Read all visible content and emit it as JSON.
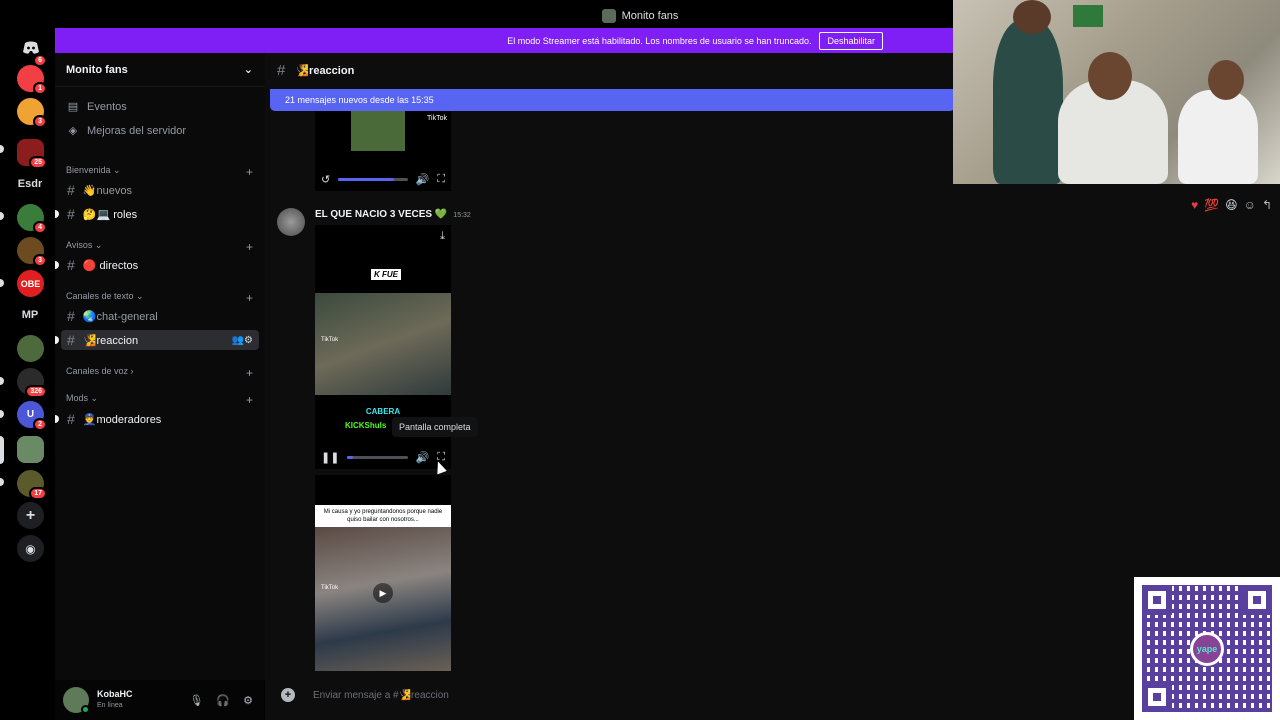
{
  "window": {
    "title": "Monito fans"
  },
  "banner": {
    "text": "El modo Streamer está habilitado. Los nombres de usuario se han truncado.",
    "button": "Deshabilitar"
  },
  "rail": {
    "text_items": [
      "Esdr",
      "MP"
    ],
    "badges": [
      "6",
      "1",
      "3",
      "25",
      "4",
      "3",
      "326",
      "2",
      "17"
    ],
    "server_labels": [
      "OBE",
      "U"
    ]
  },
  "sidebar": {
    "guild_name": "Monito fans",
    "top_items": [
      {
        "label": "Eventos",
        "icon": "calendar-icon"
      },
      {
        "label": "Mejoras del servidor",
        "icon": "boost-icon"
      }
    ],
    "categories": {
      "bienvenida": "Bienvenida",
      "avisos": "Avisos",
      "texto": "Canales de texto",
      "voz": "Canales de voz",
      "mods": "Mods"
    },
    "channels": {
      "nuevos": "👋nuevos",
      "roles": "🤔💻 roles",
      "directos": "🔴 directos",
      "chat_general": "🌏chat-general",
      "reaccion": "🧏reaccion",
      "moderadores": "👮moderadores"
    },
    "channel_tools": "👥⚙"
  },
  "user": {
    "name": "KobaHC",
    "status": "En línea"
  },
  "chat": {
    "channel_name": "🧏reaccion",
    "new_messages": "21 mensajes nuevos desde las 15:35",
    "author": "EL QUE NACIO 3 VECES 💚",
    "time": "15:32",
    "tooltip": "Pantalla completa",
    "video1_label": "K FUE",
    "video1_bottom": "CABERA",
    "video1_kick": "KICKShuls",
    "video2_caption": "Mi causa y yo preguntandonos porque nadie quiso bailar con nosotros...",
    "tiktok": "TikTok",
    "input_placeholder": "Enviar mensaje a #🧏reaccion",
    "progress_top": 0.8,
    "progress_main": 0.1
  },
  "qr": {
    "logo": "yape"
  },
  "colors": {
    "accent": "#5865f2",
    "streamer": "#7f1ef5",
    "online": "#23a55a",
    "badge": "#f23f43"
  }
}
